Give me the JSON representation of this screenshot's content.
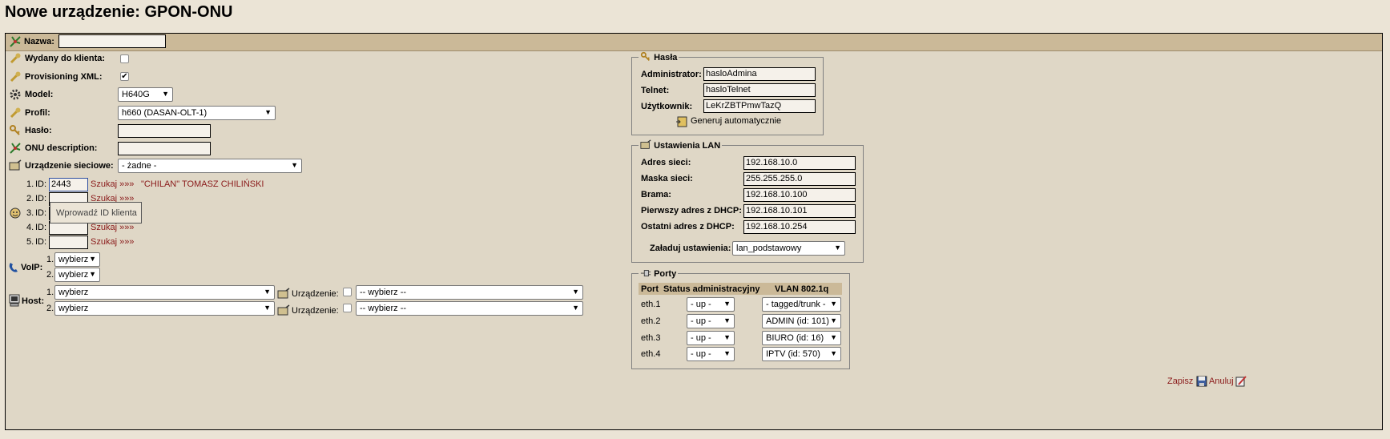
{
  "page": {
    "title": "Nowe urządzenie: GPON-ONU"
  },
  "header": {
    "name_label": "Nazwa:",
    "name_value": ""
  },
  "form": {
    "issued_label": "Wydany do klienta:",
    "issued_checked": false,
    "provisioning_label": "Provisioning XML:",
    "provisioning_checked": true,
    "model_label": "Model:",
    "model_value": "H640G",
    "profile_label": "Profil:",
    "profile_value": "h660 (DASAN-OLT-1)",
    "password_label": "Hasło:",
    "password_value": "",
    "onu_desc_label": "ONU description:",
    "onu_desc_value": "",
    "netdev_label": "Urządzenie sieciowe:",
    "netdev_value": "- żadne -"
  },
  "clients": {
    "id_label": "ID:",
    "search_label": "Szukaj »»»",
    "tooltip": "Wprowadź ID klienta",
    "rows": [
      {
        "num": "1.",
        "id": "2443",
        "customer": "\"CHILAN\" TOMASZ CHILIŃSKI"
      },
      {
        "num": "2.",
        "id": "",
        "customer": ""
      },
      {
        "num": "3.",
        "id": "",
        "customer": ""
      },
      {
        "num": "4.",
        "id": "",
        "customer": ""
      },
      {
        "num": "5.",
        "id": "",
        "customer": ""
      }
    ]
  },
  "voip": {
    "label": "VoIP:",
    "rows": [
      {
        "num": "1.",
        "value": "wybierz"
      },
      {
        "num": "2.",
        "value": "wybierz"
      }
    ]
  },
  "host": {
    "label": "Host:",
    "device_label": "Urządzenie:",
    "rows": [
      {
        "num": "1.",
        "value": "wybierz",
        "device": "-- wybierz --"
      },
      {
        "num": "2.",
        "value": "wybierz",
        "device": "-- wybierz --"
      }
    ]
  },
  "passwords": {
    "legend": "Hasła",
    "admin_label": "Administrator:",
    "admin_value": "hasloAdmina",
    "telnet_label": "Telnet:",
    "telnet_value": "hasloTelnet",
    "user_label": "Użytkownik:",
    "user_value": "LeKrZBTPmwTazQ",
    "generate_label": "Generuj automatycznie"
  },
  "lan": {
    "legend": "Ustawienia LAN",
    "network_label": "Adres sieci:",
    "network_value": "192.168.10.0",
    "mask_label": "Maska sieci:",
    "mask_value": "255.255.255.0",
    "gateway_label": "Brama:",
    "gateway_value": "192.168.10.100",
    "dhcp_first_label": "Pierwszy adres z DHCP:",
    "dhcp_first_value": "192.168.10.101",
    "dhcp_last_label": "Ostatni adres z DHCP:",
    "dhcp_last_value": "192.168.10.254",
    "load_label": "Załaduj ustawienia:",
    "load_value": "lan_podstawowy"
  },
  "ports": {
    "legend": "Porty",
    "headers": [
      "Port",
      "Status administracyjny",
      "VLAN 802.1q"
    ],
    "rows": [
      {
        "port": "eth.1",
        "status": "- up -",
        "vlan": "- tagged/trunk -"
      },
      {
        "port": "eth.2",
        "status": "- up -",
        "vlan": "ADMIN (id: 101)"
      },
      {
        "port": "eth.3",
        "status": "- up -",
        "vlan": "BIURO (id: 16)"
      },
      {
        "port": "eth.4",
        "status": "- up -",
        "vlan": "IPTV (id: 570)"
      }
    ]
  },
  "footer": {
    "save_label": "Zapisz",
    "cancel_label": "Anuluj"
  },
  "colors": {
    "header_bar": "#cbb998",
    "panel_bg": "#dfd7c6",
    "page_bg": "#ebe4d6",
    "link": "#8a1a1a"
  }
}
